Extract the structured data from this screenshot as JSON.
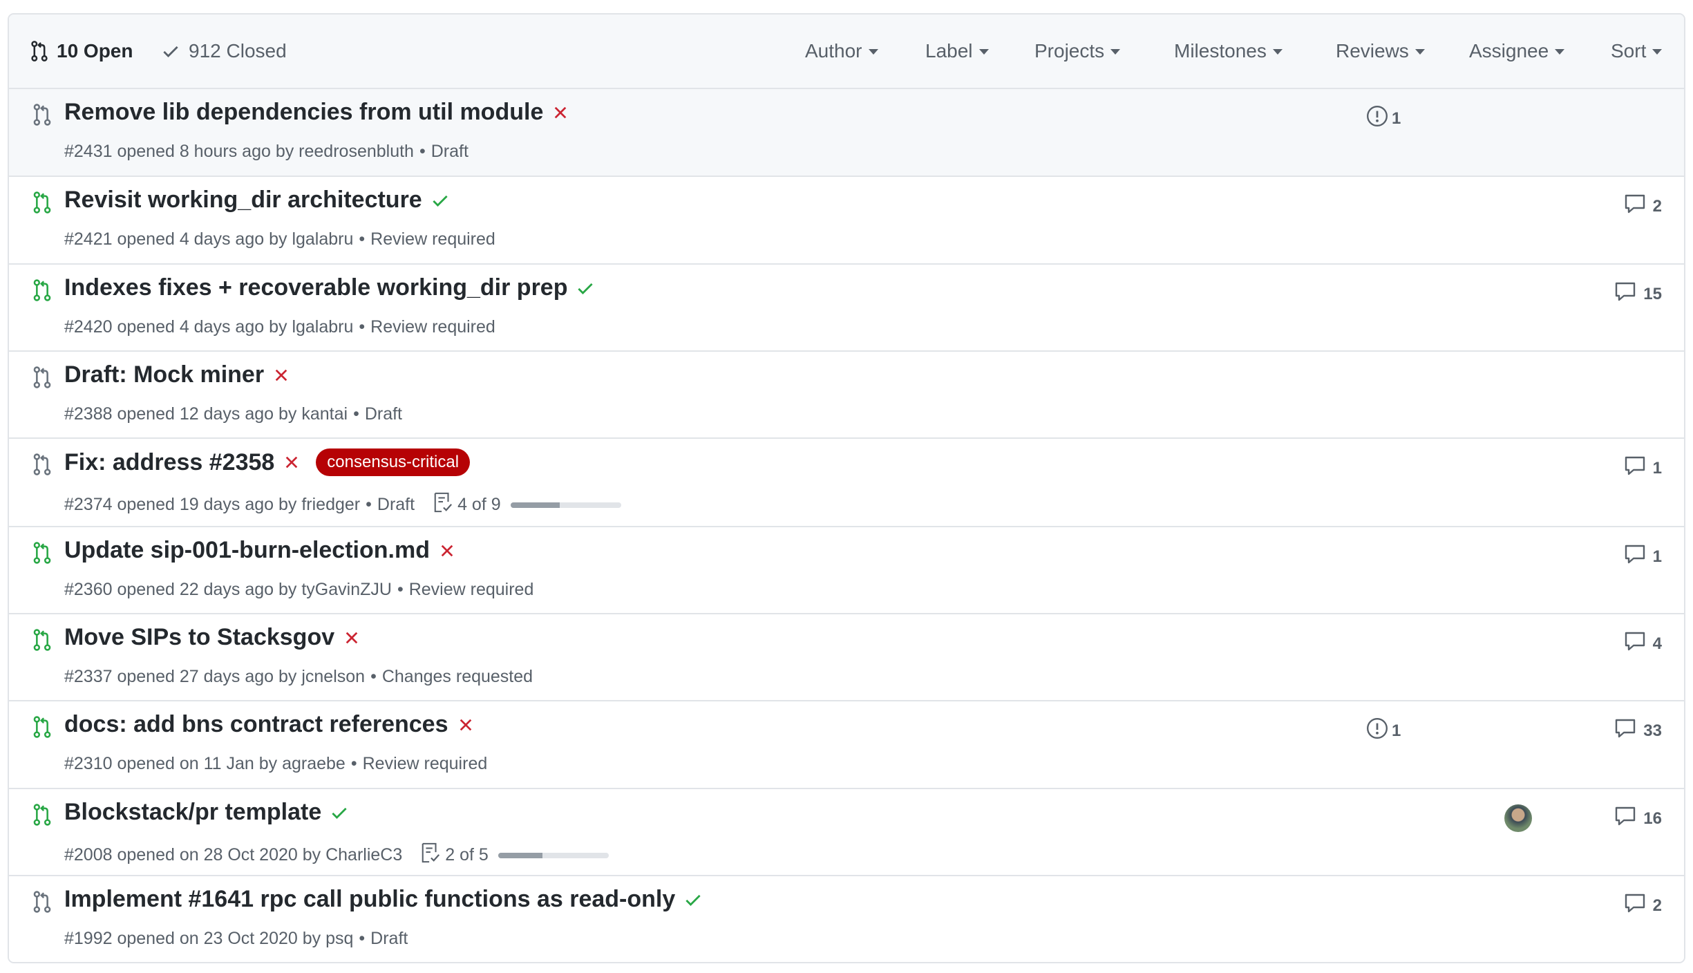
{
  "header": {
    "open_label": "10 Open",
    "closed_label": "912 Closed",
    "filters": [
      "Author",
      "Label",
      "Projects",
      "Milestones",
      "Reviews",
      "Assignee",
      "Sort"
    ]
  },
  "colors": {
    "accent_green": "#28a745",
    "fail_red": "#cb2431",
    "draft_gray": "#6a737d",
    "label_consensus": "#b60205"
  },
  "pull_requests": [
    {
      "title": "Remove lib dependencies from util module",
      "status": "fail",
      "draft": true,
      "meta": "#2431 opened 8 hours ago by reedrosenbluth",
      "state": "Draft",
      "issues": "1",
      "comments": ""
    },
    {
      "title": "Revisit working_dir architecture",
      "status": "pass",
      "draft": false,
      "meta": "#2421 opened 4 days ago by lgalabru",
      "state": "Review required",
      "issues": "",
      "comments": "2"
    },
    {
      "title": "Indexes fixes + recoverable working_dir prep",
      "status": "pass",
      "draft": false,
      "meta": "#2420 opened 4 days ago by lgalabru",
      "state": "Review required",
      "issues": "",
      "comments": "15"
    },
    {
      "title": "Draft: Mock miner",
      "status": "fail",
      "draft": true,
      "meta": "#2388 opened 12 days ago by kantai",
      "state": "Draft",
      "issues": "",
      "comments": ""
    },
    {
      "title": "Fix: address #2358",
      "status": "fail",
      "draft": true,
      "label": "consensus-critical",
      "meta": "#2374 opened 19 days ago by friedger",
      "state": "Draft",
      "tasks": "4 of 9",
      "tasks_done": 4,
      "tasks_total": 9,
      "issues": "",
      "comments": "1"
    },
    {
      "title": "Update sip-001-burn-election.md",
      "status": "fail",
      "draft": false,
      "meta": "#2360 opened 22 days ago by tyGavinZJU",
      "state": "Review required",
      "issues": "",
      "comments": "1"
    },
    {
      "title": "Move SIPs to Stacksgov",
      "status": "fail",
      "draft": false,
      "meta": "#2337 opened 27 days ago by jcnelson",
      "state": "Changes requested",
      "issues": "",
      "comments": "4"
    },
    {
      "title": "docs: add bns contract references",
      "status": "fail",
      "draft": false,
      "meta": "#2310 opened on 11 Jan by agraebe",
      "state": "Review required",
      "issues": "1",
      "comments": "33"
    },
    {
      "title": "Blockstack/pr template",
      "status": "pass",
      "draft": false,
      "meta": "#2008 opened on 28 Oct 2020 by CharlieC3",
      "state": "",
      "tasks": "2 of 5",
      "tasks_done": 2,
      "tasks_total": 5,
      "issues": "",
      "comments": "16",
      "assignee_avatar": true
    },
    {
      "title": "Implement #1641 rpc call public functions as read-only",
      "status": "pass",
      "draft": true,
      "meta": "#1992 opened on 23 Oct 2020 by psq",
      "state": "Draft",
      "issues": "",
      "comments": "2"
    }
  ]
}
